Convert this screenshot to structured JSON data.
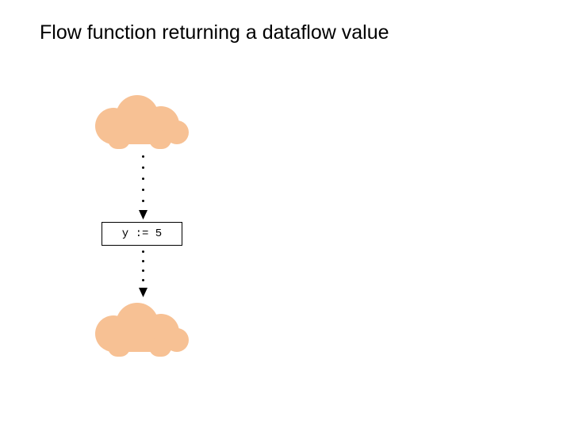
{
  "title": "Flow function returning a dataflow value",
  "stmt": "y := 5",
  "colors": {
    "cloud": "#f7c194"
  },
  "nodes": {
    "top_cloud": {
      "role": "dataflow-value-before"
    },
    "stmt_box": {
      "role": "statement"
    },
    "bottom_cloud": {
      "role": "dataflow-value-after"
    }
  },
  "edges": [
    {
      "from": "top_cloud",
      "to": "stmt_box",
      "style": "dotted-arrow"
    },
    {
      "from": "stmt_box",
      "to": "bottom_cloud",
      "style": "dotted-arrow"
    }
  ]
}
